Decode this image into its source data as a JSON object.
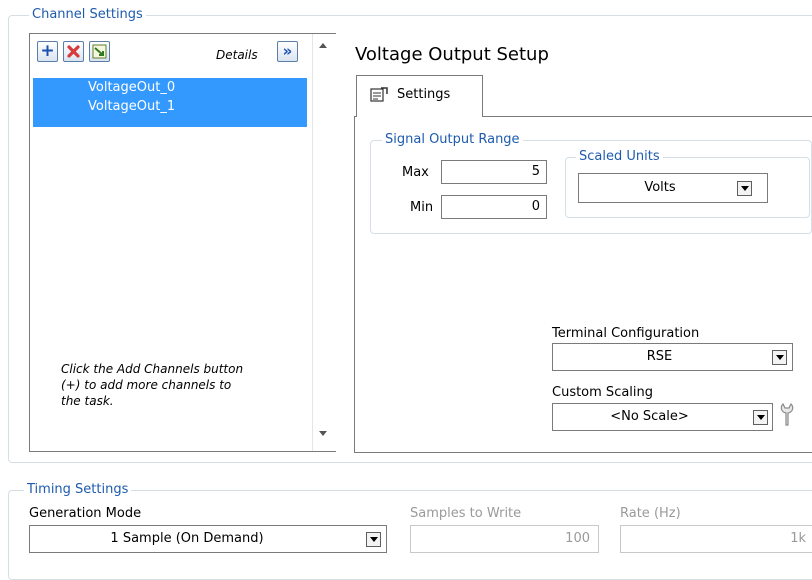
{
  "channel_settings": {
    "title": "Channel Settings",
    "details_label": "Details",
    "channels": [
      "VoltageOut_0",
      "VoltageOut_1"
    ],
    "hint": "Click the Add Channels button (+) to add more channels to the task.",
    "hint_lines": [
      "Click the Add Channels button",
      "(+) to add more channels to",
      "the task."
    ]
  },
  "setup": {
    "title": "Voltage Output Setup",
    "tab_label": "Settings",
    "signal_output_range": {
      "title": "Signal Output Range",
      "max_label": "Max",
      "max_value": "5",
      "min_label": "Min",
      "min_value": "0"
    },
    "scaled_units": {
      "title": "Scaled Units",
      "value": "Volts"
    },
    "terminal_configuration": {
      "label": "Terminal Configuration",
      "value": "RSE"
    },
    "custom_scaling": {
      "label": "Custom Scaling",
      "value": "<No Scale>"
    }
  },
  "timing_settings": {
    "title": "Timing Settings",
    "generation_mode_label": "Generation Mode",
    "generation_mode_value": "1 Sample (On Demand)",
    "samples_to_write_label": "Samples to Write",
    "samples_to_write_value": "100",
    "rate_label": "Rate (Hz)",
    "rate_value": "1k"
  },
  "colors": {
    "accent_blue": "#1e5bad",
    "selection": "#3399ff",
    "remove_red": "#d83b3b"
  },
  "icons": [
    "add-icon",
    "remove-icon",
    "channel-browse-icon",
    "details-expand-icon",
    "settings-tab-icon",
    "wrench-icon"
  ]
}
